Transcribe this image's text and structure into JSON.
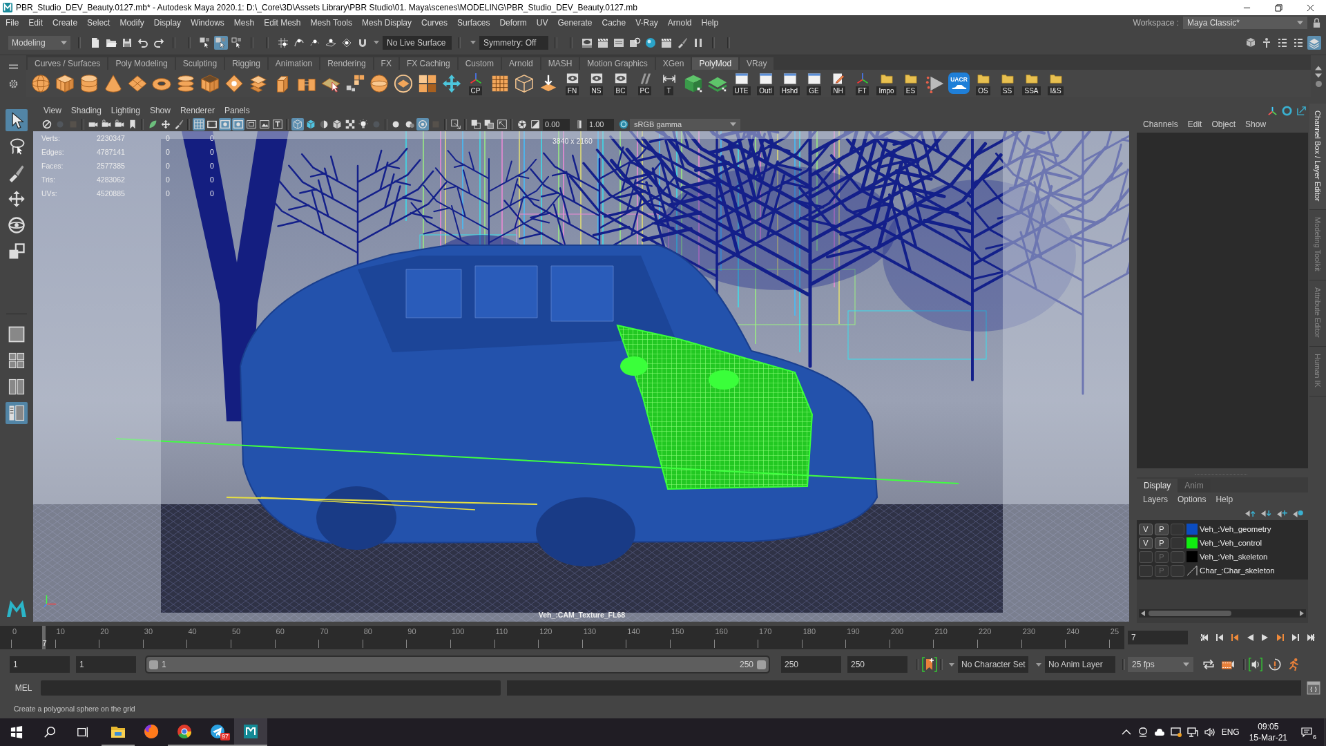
{
  "window": {
    "title": "PBR_Studio_DEV_Beauty.0127.mb* - Autodesk Maya 2020.1: D:\\_Core\\3D\\Assets Library\\PBR Studio\\01. Maya\\scenes\\MODELING\\PBR_Studio_DEV_Beauty.0127.mb"
  },
  "menu_bar": {
    "items": [
      "File",
      "Edit",
      "Create",
      "Select",
      "Modify",
      "Display",
      "Windows",
      "Mesh",
      "Edit Mesh",
      "Mesh Tools",
      "Mesh Display",
      "Curves",
      "Surfaces",
      "Deform",
      "UV",
      "Generate",
      "Cache",
      "V-Ray",
      "Arnold",
      "Help"
    ],
    "workspace_label": "Workspace :",
    "workspace": "Maya Classic*"
  },
  "status_line": {
    "menu_set": "Modeling",
    "select_modes": [
      {
        "selected": false
      },
      {
        "selected": true
      },
      {
        "selected": false
      }
    ],
    "live_surface": "No Live Surface",
    "symmetry": "Symmetry: Off",
    "panel_toggles": [
      {
        "on": false
      },
      {
        "on": false
      },
      {
        "on": false
      },
      {
        "on": false
      },
      {
        "on": true
      }
    ]
  },
  "shelf": {
    "tabs": [
      {
        "label": "Curves / Surfaces",
        "selected": false
      },
      {
        "label": "Poly Modeling",
        "selected": false
      },
      {
        "label": "Sculpting",
        "selected": false
      },
      {
        "label": "Rigging",
        "selected": false
      },
      {
        "label": "Animation",
        "selected": false
      },
      {
        "label": "Rendering",
        "selected": false
      },
      {
        "label": "FX",
        "selected": false
      },
      {
        "label": "FX Caching",
        "selected": false
      },
      {
        "label": "Custom",
        "selected": false
      },
      {
        "label": "Arnold",
        "selected": false
      },
      {
        "label": "MASH",
        "selected": false
      },
      {
        "label": "Motion Graphics",
        "selected": false
      },
      {
        "label": "XGen",
        "selected": false
      },
      {
        "label": "PolyMod",
        "selected": true
      },
      {
        "label": "VRay",
        "selected": false
      }
    ],
    "buttons": [
      {
        "kind": "tagged",
        "label": "CP"
      },
      {
        "kind": "tagged",
        "label": "FN"
      },
      {
        "kind": "tagged",
        "label": "NS"
      },
      {
        "kind": "tagged",
        "label": "BC"
      },
      {
        "kind": "tagged",
        "label": "PC"
      },
      {
        "kind": "tagged",
        "label": "T"
      },
      {
        "kind": "tagged",
        "label": "UTE"
      },
      {
        "kind": "tagged",
        "label": "Outl"
      },
      {
        "kind": "tagged",
        "label": "Hshd"
      },
      {
        "kind": "tagged",
        "label": "GE"
      },
      {
        "kind": "tagged",
        "label": "NH"
      },
      {
        "kind": "tagged",
        "label": "FT"
      },
      {
        "kind": "tagged",
        "label": "Impo"
      },
      {
        "kind": "tagged",
        "label": "ES"
      },
      {
        "kind": "tile",
        "label": "UACR"
      },
      {
        "kind": "tagged",
        "label": "OS"
      },
      {
        "kind": "tagged",
        "label": "SS"
      },
      {
        "kind": "tagged",
        "label": "SSA"
      },
      {
        "kind": "tagged",
        "label": "I&S"
      }
    ]
  },
  "toolbox": {
    "tools": [
      {
        "selected": true
      },
      {
        "selected": false
      },
      {
        "selected": false
      },
      {
        "selected": false
      },
      {
        "selected": false
      },
      {
        "selected": false
      }
    ],
    "layouts": [
      {
        "selected": false
      },
      {
        "selected": false
      },
      {
        "selected": false
      },
      {
        "selected": true
      }
    ]
  },
  "viewport": {
    "menus": [
      "View",
      "Shading",
      "Lighting",
      "Show",
      "Renderer",
      "Panels"
    ],
    "toolbar": [
      {
        "on": false,
        "disabled": false
      },
      {
        "on": false,
        "disabled": true
      },
      {
        "on": false,
        "disabled": true
      },
      {
        "on": false,
        "disabled": false
      },
      {
        "on": false,
        "disabled": false
      },
      {
        "on": false,
        "disabled": false
      },
      {
        "on": false,
        "disabled": false
      },
      {
        "on": false,
        "disabled": false
      },
      {
        "on": false,
        "disabled": false
      },
      {
        "on": false,
        "disabled": false
      },
      {
        "on": true,
        "disabled": false
      },
      {
        "on": false,
        "disabled": false
      },
      {
        "on": true,
        "disabled": false
      },
      {
        "on": true,
        "disabled": false
      },
      {
        "on": false,
        "disabled": false
      },
      {
        "on": false,
        "disabled": false
      },
      {
        "on": false,
        "disabled": false
      },
      {
        "on": true,
        "disabled": false
      },
      {
        "on": false,
        "disabled": false
      },
      {
        "on": false,
        "disabled": false
      },
      {
        "on": false,
        "disabled": false
      },
      {
        "on": false,
        "disabled": false
      },
      {
        "on": false,
        "disabled": false
      },
      {
        "on": false,
        "disabled": true
      },
      {
        "on": false,
        "disabled": false
      },
      {
        "on": false,
        "disabled": false
      },
      {
        "on": true,
        "disabled": false
      },
      {
        "on": false,
        "disabled": true
      },
      {
        "on": false,
        "disabled": false
      },
      {
        "on": false,
        "disabled": false
      },
      {
        "on": false,
        "disabled": false
      },
      {
        "on": false,
        "disabled": false
      },
      {
        "on": false,
        "disabled": false
      }
    ],
    "exposure": "0.00",
    "gamma": "1.00",
    "color_space": "sRGB gamma",
    "hud": [
      {
        "label": "Verts:",
        "counts": [
          "2230347",
          "0",
          "0"
        ]
      },
      {
        "label": "Edges:",
        "counts": [
          "4787141",
          "0",
          "0"
        ]
      },
      {
        "label": "Faces:",
        "counts": [
          "2577385",
          "0",
          "0"
        ]
      },
      {
        "label": "Tris:",
        "counts": [
          "4283062",
          "0",
          "0"
        ]
      },
      {
        "label": "UVs:",
        "counts": [
          "4520885",
          "0",
          "0"
        ]
      }
    ],
    "resolution": "3840 x 2160",
    "camera": "Veh_:CAM_Texture_FL68"
  },
  "channel_box": {
    "menus": [
      "Channels",
      "Edit",
      "Object",
      "Show"
    ]
  },
  "side_tabs": [
    {
      "label": "Channel Box / Layer Editor",
      "selected": true
    },
    {
      "label": "Modeling Toolkit",
      "selected": false
    },
    {
      "label": "Attribute Editor",
      "selected": false
    },
    {
      "label": "Human IK",
      "selected": false
    }
  ],
  "layer_editor": {
    "tabs": [
      {
        "label": "Display",
        "selected": true
      },
      {
        "label": "Anim",
        "selected": false
      }
    ],
    "menus": [
      "Layers",
      "Options",
      "Help"
    ],
    "layers": [
      {
        "visible": true,
        "v_label": "V",
        "p_label": "P",
        "color": "#0b4cc0",
        "name": "Veh_:Veh_geometry"
      },
      {
        "visible": true,
        "v_label": "V",
        "p_label": "P",
        "color": "#10ee10",
        "name": "Veh_:Veh_control"
      },
      {
        "visible": false,
        "p_label": "P",
        "color": "#000000",
        "name": "Veh_:Veh_skeleton"
      },
      {
        "visible": false,
        "p_label": "P",
        "name": "Char_:Char_skeleton"
      }
    ]
  },
  "time_slider": {
    "ticks": [
      "0",
      "10",
      "20",
      "30",
      "40",
      "50",
      "60",
      "70",
      "80",
      "90",
      "100",
      "110",
      "120",
      "130",
      "140",
      "150",
      "160",
      "170",
      "180",
      "190",
      "200",
      "210",
      "220",
      "230",
      "240",
      "25"
    ],
    "current_frame": "7",
    "frame_field": "7"
  },
  "range": {
    "start": "1",
    "playback_start": "1",
    "level": 1,
    "slider_start": "1",
    "slider_end": "250",
    "playback_end": "250",
    "end": "250",
    "character_set": "No Character Set",
    "anim_layer": "No Anim Layer",
    "fps": "25 fps"
  },
  "command_line": {
    "label": "MEL"
  },
  "help_line": "Create a polygonal sphere on the grid",
  "taskbar": {
    "apps": [
      {
        "running": true,
        "selected": false
      },
      {
        "running": false,
        "selected": false
      },
      {
        "running": true,
        "selected": false
      },
      {
        "running": true,
        "selected": false,
        "badge": "97"
      },
      {
        "running": true,
        "selected": true
      }
    ],
    "language": "ENG",
    "time": "09:05",
    "date": "15-Mar-21",
    "notification_count": "6"
  }
}
